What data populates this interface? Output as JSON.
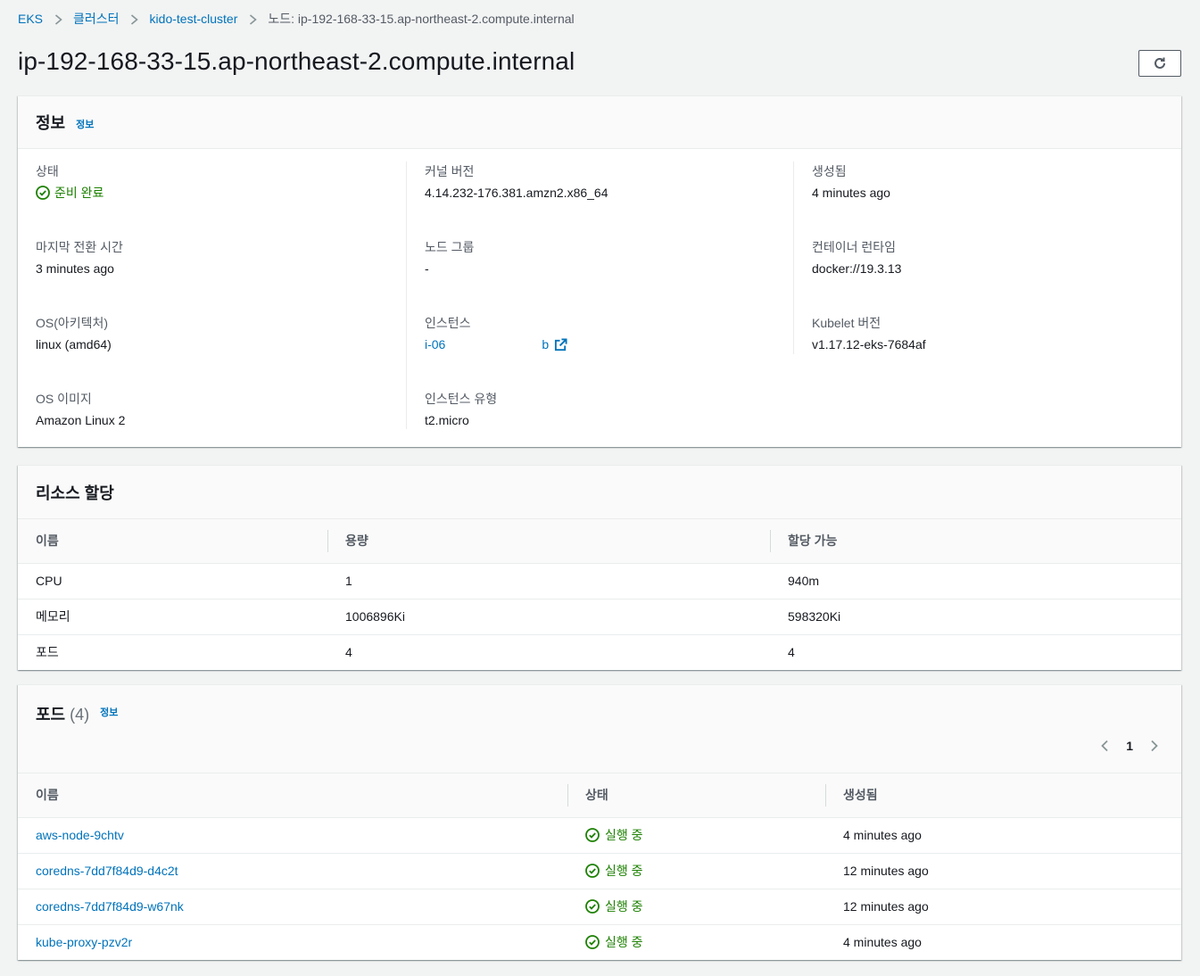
{
  "breadcrumb": {
    "items": [
      "EKS",
      "클러스터",
      "kido-test-cluster"
    ],
    "current": "노드: ip-192-168-33-15.ap-northeast-2.compute.internal"
  },
  "page": {
    "title": "ip-192-168-33-15.ap-northeast-2.compute.internal"
  },
  "info_panel": {
    "title": "정보",
    "info_link": "정보",
    "status_label": "상태",
    "status_value": "준비 완료",
    "kernel_label": "커널 버전",
    "kernel_value": "4.14.232-176.381.amzn2.x86_64",
    "created_label": "생성됨",
    "created_value": "4 minutes ago",
    "last_transition_label": "마지막 전환 시간",
    "last_transition_value": "3 minutes ago",
    "node_group_label": "노드 그룹",
    "node_group_value": "-",
    "runtime_label": "컨테이너 런타임",
    "runtime_value": "docker://19.3.13",
    "os_label": "OS(아키텍처)",
    "os_value": "linux (amd64)",
    "instance_label": "인스턴스",
    "instance_value_start": "i-06",
    "instance_value_end": "b",
    "kubelet_label": "Kubelet 버전",
    "kubelet_value": "v1.17.12-eks-7684af",
    "os_image_label": "OS 이미지",
    "os_image_value": "Amazon Linux 2",
    "instance_type_label": "인스턴스 유형",
    "instance_type_value": "t2.micro"
  },
  "resources_panel": {
    "title": "리소스 할당",
    "columns": [
      "이름",
      "용량",
      "할당 가능"
    ],
    "rows": [
      [
        "CPU",
        "1",
        "940m"
      ],
      [
        "메모리",
        "1006896Ki",
        "598320Ki"
      ],
      [
        "포드",
        "4",
        "4"
      ]
    ]
  },
  "pods_panel": {
    "title": "포드",
    "count": "(4)",
    "info_link": "정보",
    "page": "1",
    "columns": [
      "이름",
      "상태",
      "생성됨"
    ],
    "rows": [
      {
        "name": "aws-node-9chtv",
        "status": "실행 중",
        "created": "4 minutes ago"
      },
      {
        "name": "coredns-7dd7f84d9-d4c2t",
        "status": "실행 중",
        "created": "12 minutes ago"
      },
      {
        "name": "coredns-7dd7f84d9-w67nk",
        "status": "실행 중",
        "created": "12 minutes ago"
      },
      {
        "name": "kube-proxy-pzv2r",
        "status": "실행 중",
        "created": "4 minutes ago"
      }
    ]
  },
  "colors": {
    "link": "#0073bb",
    "success": "#1d8102",
    "background": "#f2f3f3"
  }
}
